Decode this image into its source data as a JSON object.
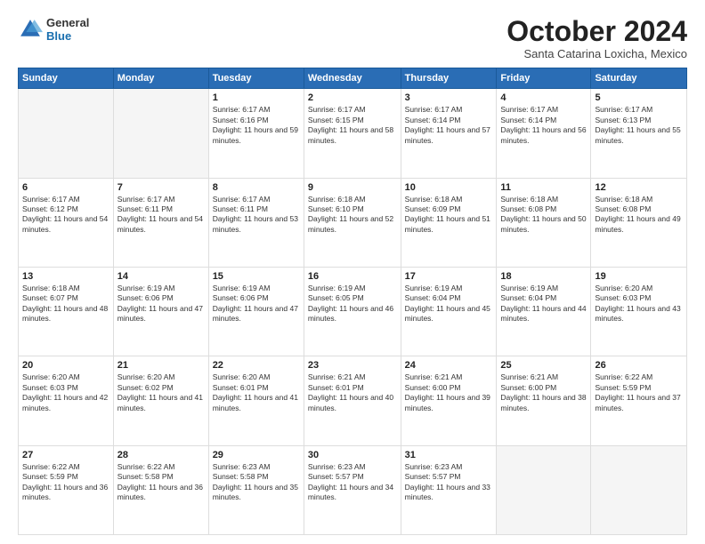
{
  "header": {
    "logo_general": "General",
    "logo_blue": "Blue",
    "month_title": "October 2024",
    "location": "Santa Catarina Loxicha, Mexico"
  },
  "days_of_week": [
    "Sunday",
    "Monday",
    "Tuesday",
    "Wednesday",
    "Thursday",
    "Friday",
    "Saturday"
  ],
  "weeks": [
    [
      {
        "day": "",
        "empty": true
      },
      {
        "day": "",
        "empty": true
      },
      {
        "day": "1",
        "sunrise": "6:17 AM",
        "sunset": "6:16 PM",
        "daylight": "11 hours and 59 minutes."
      },
      {
        "day": "2",
        "sunrise": "6:17 AM",
        "sunset": "6:15 PM",
        "daylight": "11 hours and 58 minutes."
      },
      {
        "day": "3",
        "sunrise": "6:17 AM",
        "sunset": "6:14 PM",
        "daylight": "11 hours and 57 minutes."
      },
      {
        "day": "4",
        "sunrise": "6:17 AM",
        "sunset": "6:14 PM",
        "daylight": "11 hours and 56 minutes."
      },
      {
        "day": "5",
        "sunrise": "6:17 AM",
        "sunset": "6:13 PM",
        "daylight": "11 hours and 55 minutes."
      }
    ],
    [
      {
        "day": "6",
        "sunrise": "6:17 AM",
        "sunset": "6:12 PM",
        "daylight": "11 hours and 54 minutes."
      },
      {
        "day": "7",
        "sunrise": "6:17 AM",
        "sunset": "6:11 PM",
        "daylight": "11 hours and 54 minutes."
      },
      {
        "day": "8",
        "sunrise": "6:17 AM",
        "sunset": "6:11 PM",
        "daylight": "11 hours and 53 minutes."
      },
      {
        "day": "9",
        "sunrise": "6:18 AM",
        "sunset": "6:10 PM",
        "daylight": "11 hours and 52 minutes."
      },
      {
        "day": "10",
        "sunrise": "6:18 AM",
        "sunset": "6:09 PM",
        "daylight": "11 hours and 51 minutes."
      },
      {
        "day": "11",
        "sunrise": "6:18 AM",
        "sunset": "6:08 PM",
        "daylight": "11 hours and 50 minutes."
      },
      {
        "day": "12",
        "sunrise": "6:18 AM",
        "sunset": "6:08 PM",
        "daylight": "11 hours and 49 minutes."
      }
    ],
    [
      {
        "day": "13",
        "sunrise": "6:18 AM",
        "sunset": "6:07 PM",
        "daylight": "11 hours and 48 minutes."
      },
      {
        "day": "14",
        "sunrise": "6:19 AM",
        "sunset": "6:06 PM",
        "daylight": "11 hours and 47 minutes."
      },
      {
        "day": "15",
        "sunrise": "6:19 AM",
        "sunset": "6:06 PM",
        "daylight": "11 hours and 47 minutes."
      },
      {
        "day": "16",
        "sunrise": "6:19 AM",
        "sunset": "6:05 PM",
        "daylight": "11 hours and 46 minutes."
      },
      {
        "day": "17",
        "sunrise": "6:19 AM",
        "sunset": "6:04 PM",
        "daylight": "11 hours and 45 minutes."
      },
      {
        "day": "18",
        "sunrise": "6:19 AM",
        "sunset": "6:04 PM",
        "daylight": "11 hours and 44 minutes."
      },
      {
        "day": "19",
        "sunrise": "6:20 AM",
        "sunset": "6:03 PM",
        "daylight": "11 hours and 43 minutes."
      }
    ],
    [
      {
        "day": "20",
        "sunrise": "6:20 AM",
        "sunset": "6:03 PM",
        "daylight": "11 hours and 42 minutes."
      },
      {
        "day": "21",
        "sunrise": "6:20 AM",
        "sunset": "6:02 PM",
        "daylight": "11 hours and 41 minutes."
      },
      {
        "day": "22",
        "sunrise": "6:20 AM",
        "sunset": "6:01 PM",
        "daylight": "11 hours and 41 minutes."
      },
      {
        "day": "23",
        "sunrise": "6:21 AM",
        "sunset": "6:01 PM",
        "daylight": "11 hours and 40 minutes."
      },
      {
        "day": "24",
        "sunrise": "6:21 AM",
        "sunset": "6:00 PM",
        "daylight": "11 hours and 39 minutes."
      },
      {
        "day": "25",
        "sunrise": "6:21 AM",
        "sunset": "6:00 PM",
        "daylight": "11 hours and 38 minutes."
      },
      {
        "day": "26",
        "sunrise": "6:22 AM",
        "sunset": "5:59 PM",
        "daylight": "11 hours and 37 minutes."
      }
    ],
    [
      {
        "day": "27",
        "sunrise": "6:22 AM",
        "sunset": "5:59 PM",
        "daylight": "11 hours and 36 minutes."
      },
      {
        "day": "28",
        "sunrise": "6:22 AM",
        "sunset": "5:58 PM",
        "daylight": "11 hours and 36 minutes."
      },
      {
        "day": "29",
        "sunrise": "6:23 AM",
        "sunset": "5:58 PM",
        "daylight": "11 hours and 35 minutes."
      },
      {
        "day": "30",
        "sunrise": "6:23 AM",
        "sunset": "5:57 PM",
        "daylight": "11 hours and 34 minutes."
      },
      {
        "day": "31",
        "sunrise": "6:23 AM",
        "sunset": "5:57 PM",
        "daylight": "11 hours and 33 minutes."
      },
      {
        "day": "",
        "empty": true
      },
      {
        "day": "",
        "empty": true
      }
    ]
  ]
}
